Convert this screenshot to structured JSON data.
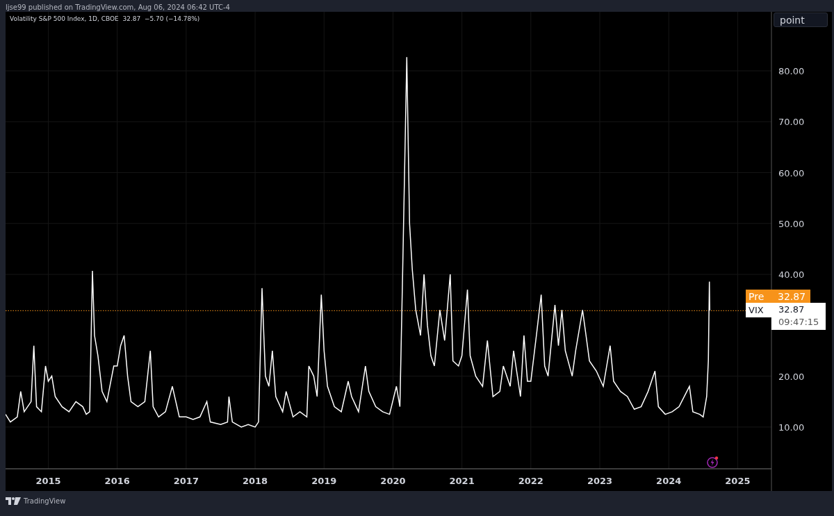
{
  "header": {
    "publisher_line": "ljse99 published on TradingView.com, Aug 06, 2024 06:42 UTC-4"
  },
  "chart": {
    "legend": "Volatility S&P 500 Index, 1D, CBOE  32.87  −5.70 (−14.78%)",
    "unit_button": "point",
    "price_labels": [
      {
        "kind": "session",
        "name": "Pre"
      },
      {
        "kind": "symbol",
        "value": "32.87",
        "countdown": "09:47:15"
      }
    ],
    "chart_data": {
      "type": "line",
      "xlim": [
        2014.38,
        2025.49
      ],
      "ylim": [
        1.8,
        91.6
      ],
      "xticks": [
        2015,
        2016,
        2017,
        2018,
        2019,
        2020,
        2021,
        2022,
        2023,
        2024,
        2025
      ],
      "grid": true,
      "ref_lines": [
        {
          "axis": "y",
          "value": 32.87,
          "label": "32.87",
          "color": "#f7931a"
        }
      ],
      "yticks": [
        {
          "value": 10,
          "label": "10.00"
        },
        {
          "value": 20,
          "label": "20.00"
        },
        {
          "value": 40,
          "label": "40.00"
        },
        {
          "value": 50,
          "label": "50.00"
        },
        {
          "value": 60,
          "label": "60.00"
        },
        {
          "value": 70,
          "label": "70.00"
        },
        {
          "value": 80,
          "label": "80.00"
        }
      ],
      "x": [
        2014.38,
        2014.45,
        2014.55,
        2014.6,
        2014.65,
        2014.75,
        2014.79,
        2014.83,
        2014.9,
        2014.96,
        2015.0,
        2015.05,
        2015.1,
        2015.2,
        2015.3,
        2015.4,
        2015.5,
        2015.55,
        2015.6,
        2015.64,
        2015.67,
        2015.72,
        2015.78,
        2015.85,
        2015.95,
        2016.0,
        2016.05,
        2016.1,
        2016.15,
        2016.2,
        2016.3,
        2016.4,
        2016.48,
        2016.52,
        2016.6,
        2016.7,
        2016.8,
        2016.85,
        2016.9,
        2017.0,
        2017.1,
        2017.2,
        2017.3,
        2017.35,
        2017.5,
        2017.6,
        2017.62,
        2017.67,
        2017.8,
        2017.9,
        2018.0,
        2018.05,
        2018.1,
        2018.15,
        2018.2,
        2018.25,
        2018.3,
        2018.4,
        2018.45,
        2018.55,
        2018.65,
        2018.75,
        2018.78,
        2018.85,
        2018.9,
        2018.96,
        2019.0,
        2019.05,
        2019.15,
        2019.25,
        2019.35,
        2019.4,
        2019.5,
        2019.6,
        2019.65,
        2019.75,
        2019.85,
        2019.95,
        2020.05,
        2020.1,
        2020.14,
        2020.2,
        2020.24,
        2020.28,
        2020.33,
        2020.4,
        2020.45,
        2020.5,
        2020.55,
        2020.6,
        2020.68,
        2020.75,
        2020.83,
        2020.87,
        2020.95,
        2021.0,
        2021.08,
        2021.12,
        2021.2,
        2021.3,
        2021.37,
        2021.45,
        2021.55,
        2021.6,
        2021.7,
        2021.75,
        2021.85,
        2021.9,
        2021.95,
        2022.0,
        2022.08,
        2022.15,
        2022.2,
        2022.25,
        2022.35,
        2022.4,
        2022.45,
        2022.5,
        2022.6,
        2022.65,
        2022.75,
        2022.8,
        2022.85,
        2022.95,
        2023.05,
        2023.15,
        2023.2,
        2023.3,
        2023.4,
        2023.5,
        2023.6,
        2023.7,
        2023.8,
        2023.85,
        2023.95,
        2024.05,
        2024.15,
        2024.3,
        2024.35,
        2024.45,
        2024.5,
        2024.55,
        2024.575,
        2024.59,
        2024.595
      ],
      "series": [
        {
          "name": "VIX",
          "color": "#ffffff",
          "values": [
            12.5,
            11,
            12,
            17,
            13,
            15,
            26,
            14,
            13,
            22,
            19,
            20,
            16,
            14,
            13,
            15,
            14,
            12.5,
            13,
            40.7,
            28,
            24,
            17,
            15,
            22,
            22,
            26,
            28,
            20,
            15,
            14,
            15,
            25,
            14,
            12,
            13,
            18,
            15,
            12,
            12,
            11.5,
            12,
            15,
            11,
            10.5,
            11,
            16,
            11,
            10,
            10.5,
            10,
            11,
            37.3,
            20,
            18,
            25,
            16,
            13,
            17,
            12,
            13,
            12,
            22,
            20,
            16,
            36,
            25,
            18,
            14,
            13,
            19,
            16,
            13,
            22,
            17,
            14,
            13,
            12.5,
            18,
            14,
            40,
            82.7,
            50,
            41,
            33,
            28,
            40,
            30,
            24,
            22,
            33,
            27,
            40,
            23,
            22,
            24,
            37,
            24,
            20,
            18,
            27,
            16,
            17,
            22,
            18,
            25,
            16,
            28,
            19,
            19,
            28,
            36,
            22,
            20,
            34,
            26,
            33,
            25,
            20,
            25,
            33,
            28,
            23,
            21,
            18,
            26,
            19,
            17,
            16,
            13.5,
            14,
            17,
            21,
            14,
            12.5,
            13,
            14,
            18,
            13,
            12.5,
            12,
            16,
            23,
            38.6,
            32.9
          ]
        }
      ]
    }
  },
  "footer": {
    "brand": "TradingView"
  }
}
